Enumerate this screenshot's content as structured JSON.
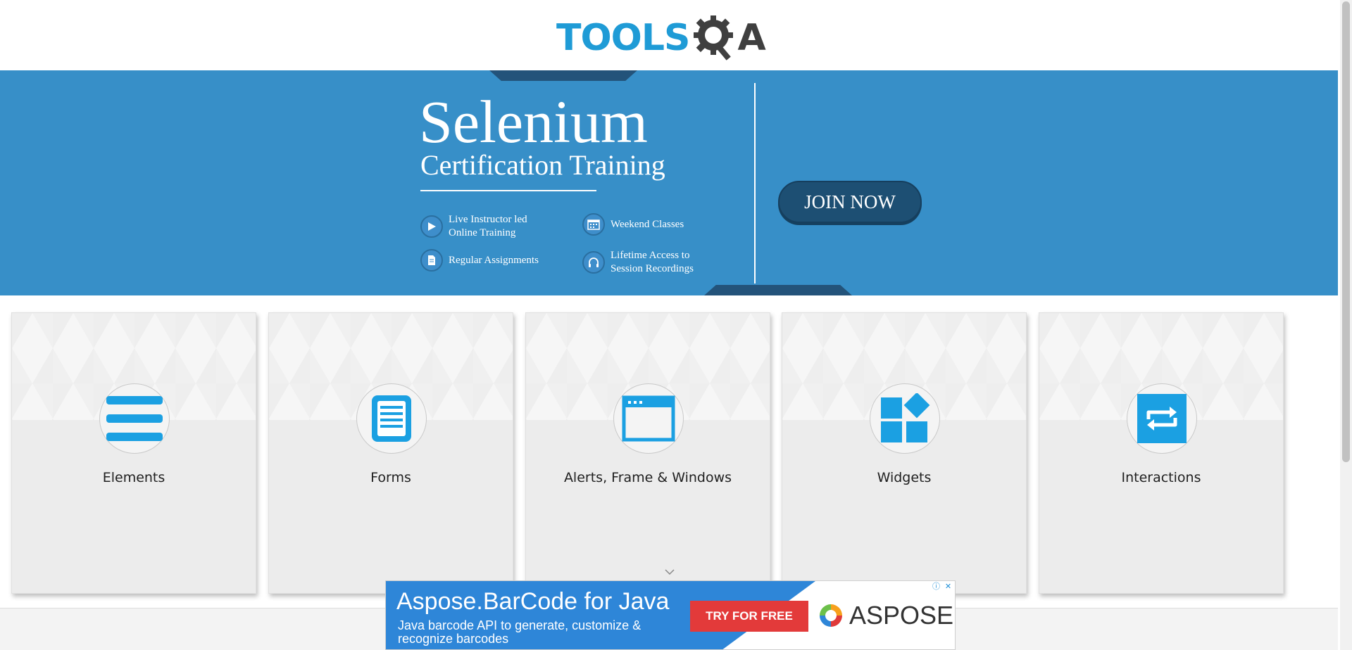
{
  "header": {
    "logo_text": "TOOLS",
    "logo_text_end": "A"
  },
  "banner": {
    "title": "Selenium",
    "subtitle": "Certification Training",
    "features": [
      {
        "label": "Live Instructor led Online Training",
        "icon": "play-icon"
      },
      {
        "label": "Weekend Classes",
        "icon": "calendar-icon"
      },
      {
        "label": "Regular Assignments",
        "icon": "document-icon"
      },
      {
        "label": "Lifetime Access to Session Recordings",
        "icon": "headphones-icon"
      }
    ],
    "cta_label": "JOIN NOW"
  },
  "cards": [
    {
      "label": "Elements",
      "icon": "elements-list-icon"
    },
    {
      "label": "Forms",
      "icon": "forms-document-icon"
    },
    {
      "label": "Alerts, Frame & Windows",
      "icon": "browser-window-icon"
    },
    {
      "label": "Widgets",
      "icon": "widgets-grid-icon"
    },
    {
      "label": "Interactions",
      "icon": "interactions-arrows-icon"
    }
  ],
  "ad": {
    "title": "Aspose.BarCode for Java",
    "description": "Java barcode API to generate, customize & recognize barcodes",
    "button_label": "TRY FOR FREE",
    "brand": "ASPOSE",
    "info_glyph": "ⓘ",
    "close_glyph": "✕"
  },
  "colors": {
    "brand_blue": "#1f9bd6",
    "banner_blue": "#378fc8",
    "banner_dark": "#1d4f73",
    "icon_blue": "#1ba0e2",
    "ad_red": "#e33a3a"
  }
}
